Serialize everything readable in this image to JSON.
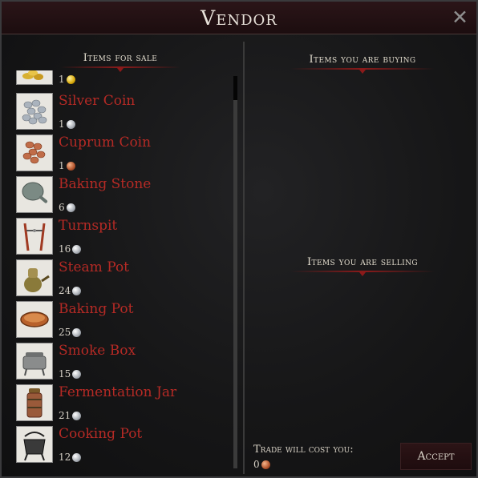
{
  "window": {
    "title": "Vendor"
  },
  "sections": {
    "for_sale": "Items for sale",
    "buying": "Items you are buying",
    "selling": "Items you are selling"
  },
  "items": [
    {
      "name": "",
      "price": "1",
      "coin": "gold",
      "icon": "gold-coin-icon"
    },
    {
      "name": "Silver Coin",
      "price": "1",
      "coin": "silver",
      "icon": "silver-coin-icon"
    },
    {
      "name": "Cuprum Coin",
      "price": "1",
      "coin": "copper",
      "icon": "cuprum-coin-icon"
    },
    {
      "name": "Baking Stone",
      "price": "6",
      "coin": "silver",
      "icon": "baking-stone-icon"
    },
    {
      "name": "Turnspit",
      "price": "16",
      "coin": "silver",
      "icon": "turnspit-icon"
    },
    {
      "name": "Steam Pot",
      "price": "24",
      "coin": "silver",
      "icon": "steam-pot-icon"
    },
    {
      "name": "Baking Pot",
      "price": "25",
      "coin": "silver",
      "icon": "baking-pot-icon"
    },
    {
      "name": "Smoke Box",
      "price": "15",
      "coin": "silver",
      "icon": "smoke-box-icon"
    },
    {
      "name": "Fermentation Jar",
      "price": "21",
      "coin": "silver",
      "icon": "fermentation-jar-icon"
    },
    {
      "name": "Cooking Pot",
      "price": "12",
      "coin": "silver",
      "icon": "cooking-pot-icon"
    }
  ],
  "trade": {
    "label": "Trade will cost you:",
    "cost": "0",
    "coin": "copper"
  },
  "accept_label": "Accept",
  "close_icon": "close-icon"
}
